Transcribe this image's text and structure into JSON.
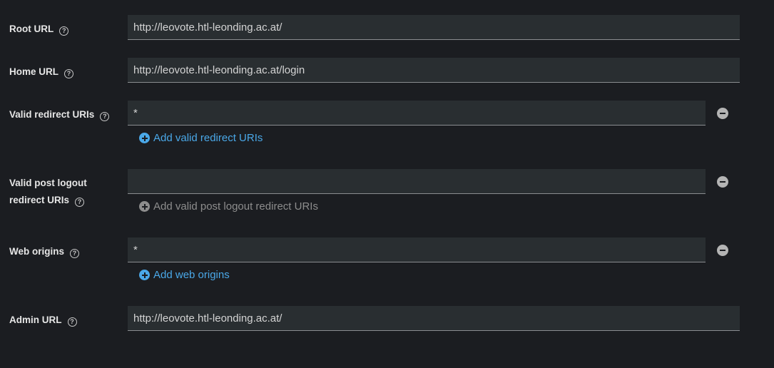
{
  "fields": {
    "root_url": {
      "label": "Root URL",
      "value": "http://leovote.htl-leonding.ac.at/"
    },
    "home_url": {
      "label": "Home URL",
      "value": "http://leovote.htl-leonding.ac.at/login"
    },
    "valid_redirect_uris": {
      "label": "Valid redirect URIs",
      "value": "*",
      "add_label": "Add valid redirect URIs"
    },
    "valid_post_logout_redirect_uris": {
      "label_line1": "Valid post logout",
      "label_line2": "redirect URIs",
      "value": "",
      "add_label": "Add valid post logout redirect URIs"
    },
    "web_origins": {
      "label": "Web origins",
      "value": "*",
      "add_label": "Add web origins"
    },
    "admin_url": {
      "label": "Admin URL",
      "value": "http://leovote.htl-leonding.ac.at/"
    }
  },
  "icons": {
    "help": "?"
  },
  "colors": {
    "background": "#1b1d21",
    "field_background": "#292e31",
    "link": "#4aa8e8",
    "disabled_link": "#8d8d8d"
  }
}
